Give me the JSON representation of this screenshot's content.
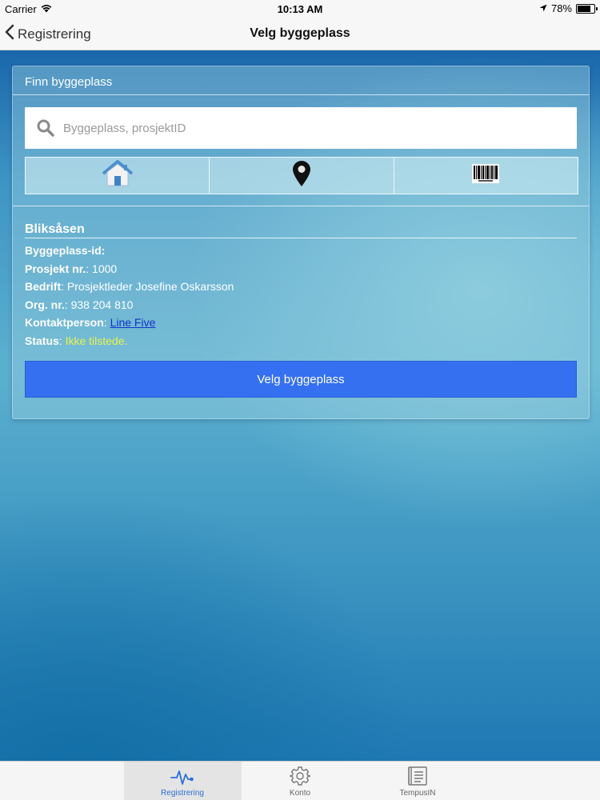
{
  "status_bar": {
    "carrier": "Carrier",
    "time": "10:13 AM",
    "battery": "78%",
    "battery_level": 0.78
  },
  "nav": {
    "back_label": "Registrering",
    "title": "Velg byggeplass"
  },
  "panel": {
    "title": "Finn byggeplass",
    "search_placeholder": "Byggeplass, prosjektID",
    "segments": [
      {
        "icon": "home-icon"
      },
      {
        "icon": "location-pin-icon"
      },
      {
        "icon": "barcode-icon"
      }
    ]
  },
  "site": {
    "name": "Bliksåsen",
    "rows": {
      "id_label": "Byggeplass-id",
      "id_value": "",
      "project_label": "Prosjekt nr.",
      "project_value": "1000",
      "company_label": "Bedrift",
      "company_value": "Prosjektleder Josefine Oskarsson",
      "org_label": "Org. nr.",
      "org_value": "938 204 810",
      "contact_label": "Kontaktperson",
      "contact_value": "Line Five",
      "status_label": "Status",
      "status_value": "Ikke tilstede."
    },
    "select_button": "Velg byggeplass"
  },
  "tabs": [
    {
      "label": "Registrering",
      "icon": "activity-pulse-icon",
      "active": true
    },
    {
      "label": "Konto",
      "icon": "gear-icon",
      "active": false
    },
    {
      "label": "TempusIN",
      "icon": "document-icon",
      "active": false
    }
  ],
  "colors": {
    "accent_blue": "#3470f0",
    "status_yellow": "#e8f24a",
    "link_blue": "#1232c8",
    "tab_active": "#2c6fd8"
  }
}
